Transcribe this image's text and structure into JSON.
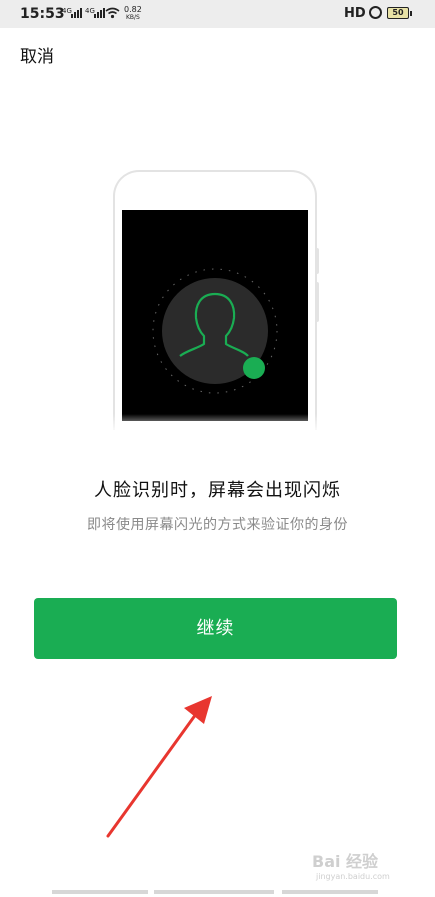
{
  "status_bar": {
    "time": "15:53",
    "net1": "4G",
    "net2": "4G",
    "speed_value": "0.82",
    "speed_unit": "KB/S",
    "hd": "HD",
    "battery": "50"
  },
  "cancel_label": "取消",
  "headline": "人脸识别时，屏幕会出现闪烁",
  "subline": "即将使用屏幕闪光的方式来验证你的身份",
  "continue_label": "继续",
  "watermark": {
    "brand": "Bai 经验",
    "url": "jingyan.baidu.com"
  },
  "colors": {
    "accent": "#1aad53",
    "screen": "#000000",
    "arrow": "#e8362f"
  }
}
